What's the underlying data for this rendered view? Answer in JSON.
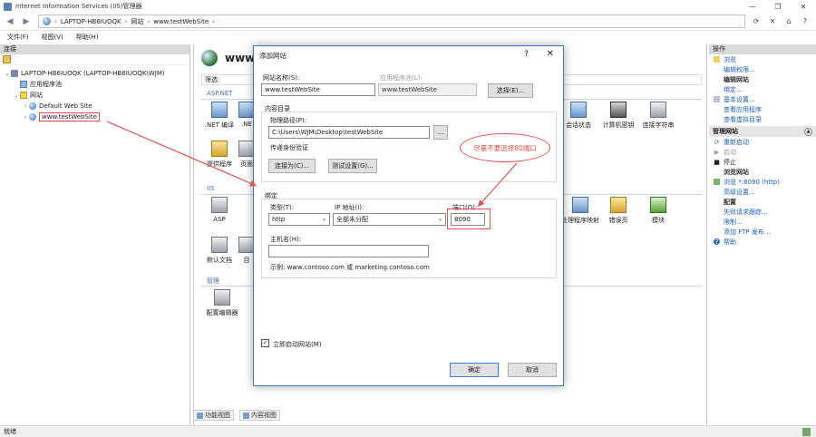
{
  "window": {
    "title": "Internet Information Services (IIS)管理器",
    "buttons": [
      "—",
      "❐",
      "✕"
    ]
  },
  "address": {
    "crumbs": [
      "LAPTOP-HB6IUOQK",
      "网站",
      "www.testWebSite"
    ]
  },
  "menu": [
    "文件(F)",
    "视图(V)",
    "帮助(H)"
  ],
  "connections": {
    "header": "连接",
    "tree": [
      {
        "label": "LAPTOP-HB6IUOQK (LAPTOP-HB6IUOQK\\WJM)",
        "level": 0,
        "expander": "⌄",
        "icon": "server-icon"
      },
      {
        "label": "应用程序池",
        "level": 1,
        "expander": "",
        "icon": "app-pool-icon"
      },
      {
        "label": "网站",
        "level": 1,
        "expander": "⌄",
        "icon": "folder-icon"
      },
      {
        "label": "Default Web Site",
        "level": 2,
        "expander": "›",
        "icon": "globe-icon"
      },
      {
        "label": "www.testWebSite",
        "level": 2,
        "expander": "›",
        "icon": "globe-icon",
        "selected": true
      }
    ]
  },
  "center": {
    "title": "www.",
    "filter_label": "筛选:",
    "sections": {
      "aspnet": "ASP.NET",
      "iis": "IIS",
      "manage": "管理"
    },
    "features_aspnet": [
      ".NET 编译",
      ".NE",
      "会话状态",
      "计算机密钥",
      "连接字符串"
    ],
    "features_aspnet2": [
      "提供程序",
      "页面"
    ],
    "features_iis": [
      "ASP",
      "处理程序映射",
      "错误页",
      "模块"
    ],
    "features_iis2": [
      "默认文档",
      "目"
    ],
    "features_manage": [
      "配置编辑器"
    ]
  },
  "bottom_tabs": [
    "功能视图",
    "内容视图"
  ],
  "actions": {
    "header": "操作",
    "items_top": [
      {
        "label": "浏览",
        "type": "link",
        "icon": "explore-icon"
      },
      {
        "label": "编辑权限...",
        "type": "link",
        "icon": ""
      },
      {
        "label": "编辑网站",
        "type": "title",
        "icon": ""
      },
      {
        "label": "绑定...",
        "type": "link",
        "icon": ""
      },
      {
        "label": "基本设置...",
        "type": "link",
        "icon": "settings-icon"
      },
      {
        "label": "查看应用程序",
        "type": "link",
        "icon": ""
      },
      {
        "label": "查看虚拟目录",
        "type": "link",
        "icon": ""
      }
    ],
    "manage_section": "管理网站",
    "items_manage": [
      {
        "label": "重新启动",
        "type": "link",
        "icon": "restart-icon"
      },
      {
        "label": "启动",
        "type": "disabled",
        "icon": "start-icon"
      },
      {
        "label": "停止",
        "type": "plain",
        "icon": "stop-icon"
      },
      {
        "label": "浏览网站",
        "type": "title",
        "icon": ""
      },
      {
        "label": "浏览 *:8090 (http)",
        "type": "link",
        "icon": "browse-icon"
      },
      {
        "label": "高级设置...",
        "type": "link",
        "icon": ""
      },
      {
        "label": "配置",
        "type": "title",
        "icon": ""
      },
      {
        "label": "失败请求跟踪...",
        "type": "link",
        "icon": ""
      },
      {
        "label": "限制...",
        "type": "link",
        "icon": ""
      },
      {
        "label": "添加 FTP 发布...",
        "type": "link",
        "icon": ""
      },
      {
        "label": "帮助",
        "type": "link",
        "icon": "help-icon"
      }
    ]
  },
  "status": "就绪",
  "dialog": {
    "title": "添加网站",
    "help": "?",
    "close": "✕",
    "site_name_label": "网站名称(S):",
    "site_name_value": "www.testWebSite",
    "app_pool_label": "应用程序池(L):",
    "app_pool_value": "www.testWebSite",
    "select_button": "选择(E)...",
    "content_dir_label": "内容目录",
    "physical_path_label": "物理路径(P):",
    "physical_path_value": "C:\\Users\\WJM\\Desktop\\testWebSite",
    "browse_button": "...",
    "pass_auth_label": "传递身份验证",
    "connect_as_button": "连接为(C)...",
    "test_settings_button": "测试设置(G)...",
    "binding_label": "绑定",
    "type_label": "类型(T):",
    "type_value": "http",
    "ip_label": "IP 地址(I):",
    "ip_value": "全部未分配",
    "port_label": "端口(O):",
    "port_value": "8090",
    "hostname_label": "主机名(H):",
    "hostname_value": "",
    "example_text": "示例: www.contoso.com 或 marketing.contoso.com",
    "start_immediately_label": "立即启动网站(M)",
    "start_immediately_checked": "✓",
    "ok_button": "确定",
    "cancel_button": "取消"
  },
  "annotation": {
    "callout_text": "尽量不要选择80端口",
    "color": "#e35050"
  }
}
